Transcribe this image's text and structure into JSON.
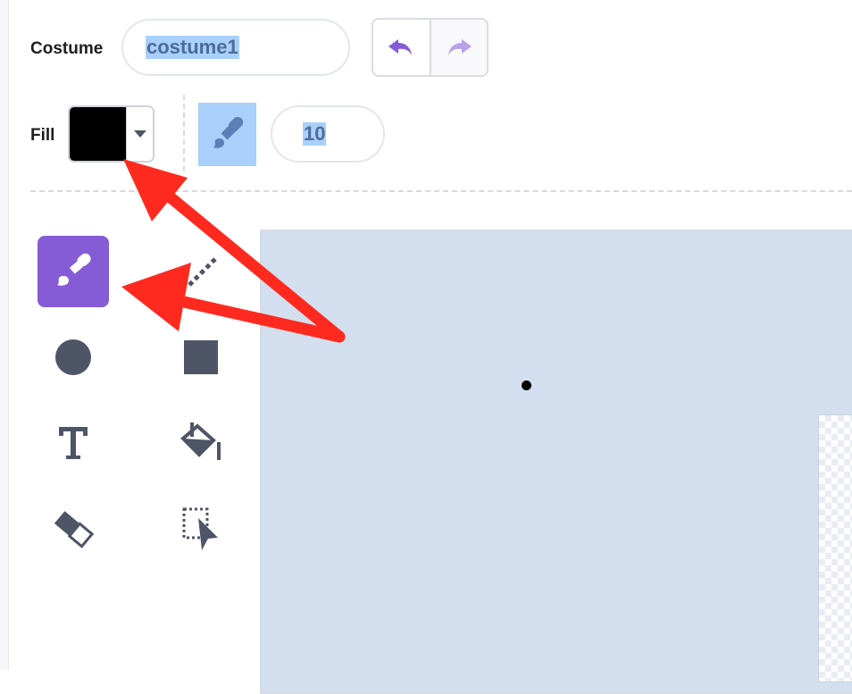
{
  "costume": {
    "label": "Costume",
    "name_value": "costume1"
  },
  "history": {
    "undo_icon": "undo-icon",
    "redo_icon": "redo-icon"
  },
  "fill": {
    "label": "Fill",
    "color": "#000000"
  },
  "brush": {
    "size_value": "10",
    "mode_icon": "brush-icon"
  },
  "tools": [
    {
      "name": "brush",
      "icon": "brush-icon",
      "active": true
    },
    {
      "name": "line",
      "icon": "line-icon",
      "active": false
    },
    {
      "name": "circle",
      "icon": "circle-icon",
      "active": false
    },
    {
      "name": "rectangle",
      "icon": "rectangle-icon",
      "active": false
    },
    {
      "name": "text",
      "icon": "text-icon",
      "active": false
    },
    {
      "name": "fill",
      "icon": "fill-bucket-icon",
      "active": false
    },
    {
      "name": "eraser",
      "icon": "eraser-icon",
      "active": false
    },
    {
      "name": "select",
      "icon": "select-icon",
      "active": false
    }
  ],
  "colors": {
    "accent": "#855cd6",
    "selection": "#a8d0fb",
    "canvas": "#d3dfee",
    "tool_icon": "#4d5566",
    "annotation_arrow": "#ff2a1f"
  }
}
